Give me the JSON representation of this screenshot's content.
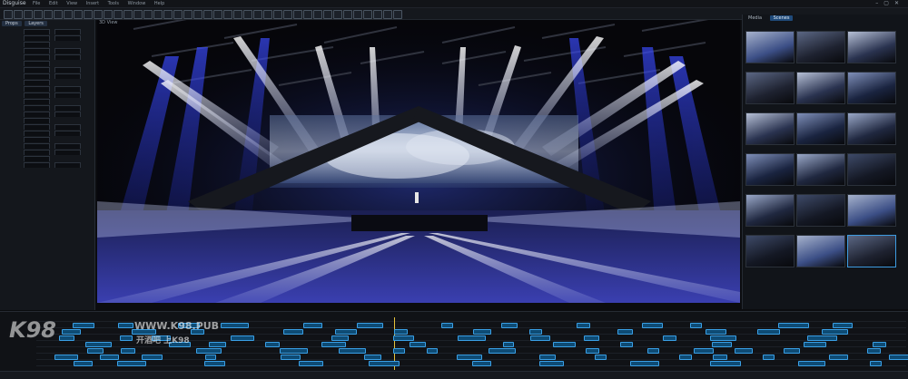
{
  "app": {
    "title": "Disguise",
    "menus": [
      "File",
      "Edit",
      "View",
      "Insert",
      "Tools",
      "Window",
      "Help"
    ]
  },
  "left_panel": {
    "tabs": [
      "Props",
      "Layers"
    ]
  },
  "viewport": {
    "label": "3D View"
  },
  "right_panel": {
    "tabs": [
      "Media",
      "Scenes"
    ],
    "active_tab": "Scenes"
  },
  "watermark": {
    "logo": "K98",
    "url": "WWW.K98.PUB",
    "tagline": "开酒吧 上K98"
  },
  "colors": {
    "accent": "#3aa0e6",
    "beam": "#2a3bd6",
    "cue_fill": "#0e4b74"
  }
}
